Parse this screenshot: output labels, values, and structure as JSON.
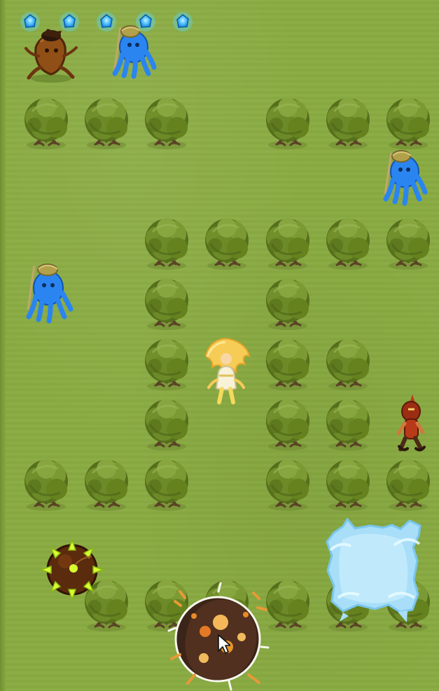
{
  "game": {
    "palette": {
      "grass": "#8aab42",
      "tree_dark": "#566f1c",
      "tree_light": "#87a63e",
      "gem_blue": "#55c4ff",
      "player_hair": "#f6cc57",
      "frost_blue": "#a8def8",
      "boulder_brown": "#3b2418",
      "spike_yellow": "#d7ff2e",
      "enemy_red": "#b93a18"
    },
    "hud": {
      "gem_icons": [
        "gem-icon",
        "gem-icon",
        "gem-icon",
        "gem-icon",
        "gem-icon"
      ]
    },
    "entities": {
      "player": "player-character",
      "blue_octopus_enemies": 3,
      "root_stump_enemy": 1,
      "red_warrior_enemy": 1,
      "spiked_mine": 1,
      "boulder_explosion": 1,
      "frost_splash": 1
    }
  }
}
